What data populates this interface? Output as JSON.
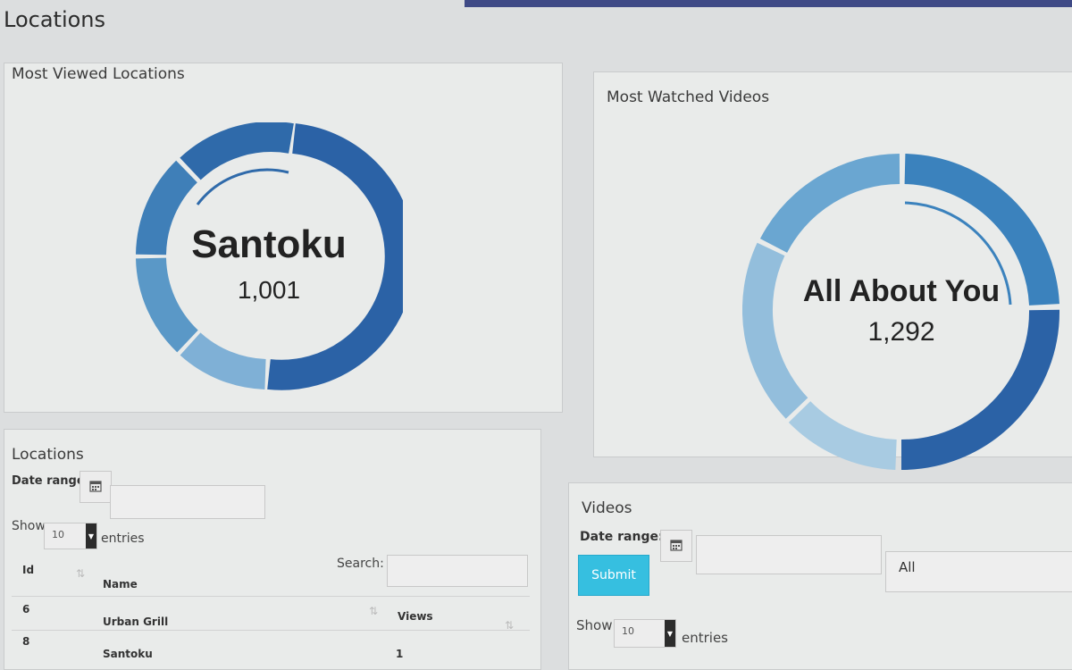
{
  "page": {
    "title": "Locations"
  },
  "location_chart": {
    "title": "Most Viewed Locations",
    "center_name": "Santoku",
    "center_value": "1,001"
  },
  "video_chart": {
    "title": "Most Watched Videos",
    "center_name": "All About You",
    "center_value": "1,292"
  },
  "locations_table": {
    "title": "Locations",
    "date_range_label": "Date range:",
    "date_range_value": "",
    "show_label": "Show",
    "entries_label": "entries",
    "page_size": "10",
    "search_label": "Search:",
    "search_value": "",
    "columns": [
      "Id",
      "Name",
      "Views"
    ],
    "rows": [
      {
        "id": "6",
        "name": "Urban Grill",
        "views": ""
      },
      {
        "id": "8",
        "name": "Santoku",
        "views": "1"
      }
    ]
  },
  "videos_table": {
    "title": "Videos",
    "date_range_label": "Date range:",
    "date_range_value": "",
    "submit_label": "Submit",
    "filter_value": "All",
    "show_label": "Show",
    "entries_label": "entries",
    "page_size": "10"
  },
  "colors": {
    "donut_dark": "#2b62a6",
    "donut_mid": "#3f7fb8",
    "donut_light": "#7fb0d6",
    "donut_pale": "#a8cbe2",
    "submit": "#36bfe0"
  },
  "icons": [
    "calendar-icon",
    "sort-icon",
    "caret-down-icon"
  ]
}
